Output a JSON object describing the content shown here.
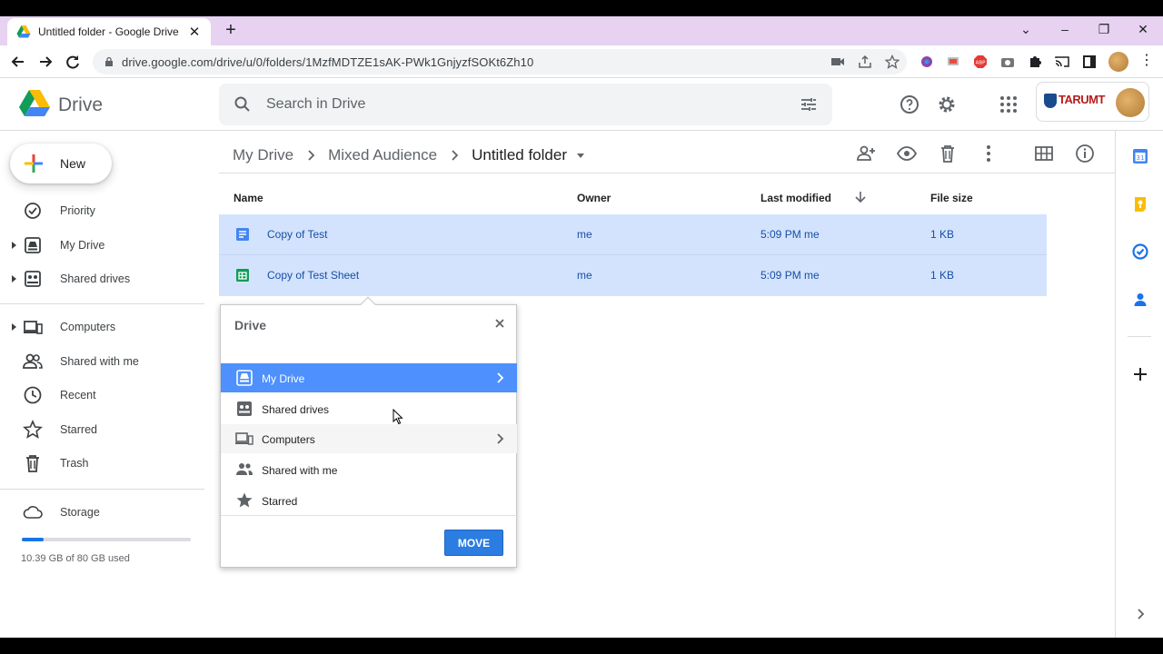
{
  "browser": {
    "tab_title": "Untitled folder - Google Drive",
    "url": "drive.google.com/drive/u/0/folders/1MzfMDTZE1sAK-PWk1GnjyzfSOKt6Zh10"
  },
  "header": {
    "app_name": "Drive",
    "search_placeholder": "Search in Drive",
    "org_name": "TARUMT"
  },
  "sidebar": {
    "new_label": "New",
    "items": [
      {
        "label": "Priority",
        "icon": "priority-icon"
      },
      {
        "label": "My Drive",
        "icon": "my-drive-icon"
      },
      {
        "label": "Shared drives",
        "icon": "shared-drives-icon"
      },
      {
        "label": "Computers",
        "icon": "computers-icon"
      },
      {
        "label": "Shared with me",
        "icon": "shared-with-me-icon"
      },
      {
        "label": "Recent",
        "icon": "clock-icon"
      },
      {
        "label": "Starred",
        "icon": "star-icon"
      },
      {
        "label": "Trash",
        "icon": "trash-icon"
      }
    ],
    "storage": {
      "label": "Storage",
      "used_text": "10.39 GB of 80 GB used",
      "used_fraction": 0.13
    }
  },
  "breadcrumb": [
    "My Drive",
    "Mixed Audience",
    "Untitled folder"
  ],
  "table": {
    "columns": [
      "Name",
      "Owner",
      "Last modified",
      "File size"
    ],
    "rows": [
      {
        "name": "Copy of Test",
        "type": "doc",
        "owner": "me",
        "modified": "5:09 PM me",
        "size": "1 KB"
      },
      {
        "name": "Copy of Test Sheet",
        "type": "sheet",
        "owner": "me",
        "modified": "5:09 PM me",
        "size": "1 KB"
      }
    ]
  },
  "move_dialog": {
    "title": "Drive",
    "items": [
      "My Drive",
      "Shared drives",
      "Computers",
      "Shared with me",
      "Starred"
    ],
    "move_label": "MOVE"
  },
  "colors": {
    "accent": "#1a73e8",
    "selection": "#d3e3fd",
    "dialog_selection": "#4d90fe",
    "tab_strip": "#e7d2f2"
  }
}
